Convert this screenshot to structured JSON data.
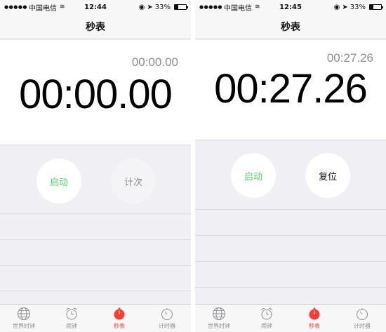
{
  "screens": [
    {
      "status": {
        "carrier": "中国电信",
        "time": "12:44",
        "battery": "33%"
      },
      "title": "秒表",
      "lap_time": "00:00.00",
      "main_time": "00:00.00",
      "left_button": "启动",
      "right_button": "计次",
      "tabs": [
        {
          "label": "世界时钟",
          "icon": "globe-icon"
        },
        {
          "label": "闹钟",
          "icon": "alarm-clock-icon"
        },
        {
          "label": "秒表",
          "icon": "stopwatch-icon"
        },
        {
          "label": "计时器",
          "icon": "timer-icon"
        }
      ],
      "active_tab": 2
    },
    {
      "status": {
        "carrier": "中国电信",
        "time": "12:45",
        "battery": "33%"
      },
      "title": "秒表",
      "lap_time": "00:27.26",
      "main_time": "00:27.26",
      "left_button": "启动",
      "right_button": "复位",
      "tabs": [
        {
          "label": "世界时钟",
          "icon": "globe-icon"
        },
        {
          "label": "闹钟",
          "icon": "alarm-clock-icon"
        },
        {
          "label": "秒表",
          "icon": "stopwatch-icon"
        },
        {
          "label": "计时器",
          "icon": "timer-icon"
        }
      ],
      "active_tab": 2
    }
  ],
  "colors": {
    "start_green": "#4cd964",
    "active_red": "#ff3b30",
    "inactive_gray": "#8e8e93"
  },
  "battery_level": 0.33
}
